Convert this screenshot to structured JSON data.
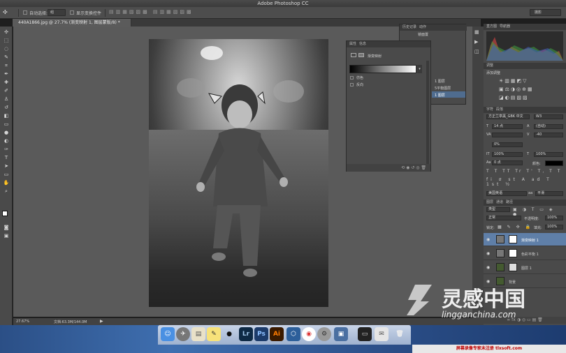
{
  "app": {
    "title": "Adobe Photoshop CC"
  },
  "options_bar": {
    "auto_select_label": "自动选择:",
    "auto_select_value": "组",
    "show_transform_label": "显示变换控件",
    "workspace": "摄影"
  },
  "document": {
    "tab_title": "440A1866.jpg @ 27.7% (渐变映射 1, 图层蒙版/8) *",
    "zoom": "27.67%",
    "doc_size": "文档:63.3M/144.0M"
  },
  "history_panel": {
    "tabs": [
      "历史记录",
      "动作"
    ],
    "items": [
      "镜面置",
      "",
      "",
      "",
      "",
      "1 图层",
      "5平衡图层",
      "1 图层"
    ]
  },
  "properties_panel": {
    "tabs": [
      "属性",
      "信息"
    ],
    "title": "渐变映射",
    "options": [
      "仿色",
      "反向"
    ]
  },
  "histogram_panel": {
    "tabs": [
      "直方图",
      "导航器"
    ]
  },
  "adjustments_panel": {
    "tabs": [
      "调整"
    ],
    "label": "添加调整"
  },
  "character_panel": {
    "tabs": [
      "字符",
      "段落"
    ],
    "font_family": "方正兰亭黑_GBK 中文",
    "font_style": "W3",
    "font_size": "14 点",
    "leading": "(自动)",
    "kerning_label": "VA",
    "tracking": "-40",
    "scale_percent": "0%",
    "vertical_scale": "100%",
    "horizontal_scale": "100%",
    "baseline": "0 点",
    "color_label": "颜色:",
    "language": "美国英语",
    "antialias": "平滑"
  },
  "layers_panel": {
    "tabs": [
      "图层",
      "通道",
      "路径"
    ],
    "filter": "类型",
    "blend_mode": "正常",
    "opacity_label": "不透明度:",
    "opacity": "100%",
    "lock_label": "锁定:",
    "fill_label": "填充:",
    "fill": "100%",
    "layers": [
      {
        "name": "渐变映射 1",
        "selected": true
      },
      {
        "name": "色彩平衡 1",
        "selected": false
      },
      {
        "name": "图层 1",
        "selected": false
      },
      {
        "name": "背景",
        "selected": false
      }
    ]
  },
  "dock": {
    "apps": [
      "Finder",
      "Launchpad",
      "Preview",
      "Notes",
      "QQ",
      "Lr",
      "Ps",
      "Ai",
      "Photo Browser",
      "Safari",
      "Chrome",
      "System Preferences",
      "Camera",
      "Terminal",
      "Mail",
      "Trash"
    ]
  },
  "watermark": {
    "brand_cn": "灵感中国",
    "brand_en": "lingganchina.com"
  },
  "footer_banner": "屏幕录像专家未注册 tlxsoft.com",
  "colors": {
    "accent": "#5f7fa8",
    "selection": "#4f6c8f",
    "ps_blue": "#1c3b6a",
    "lr_blue": "#0e2a45",
    "ai_orange": "#ff7c00"
  }
}
